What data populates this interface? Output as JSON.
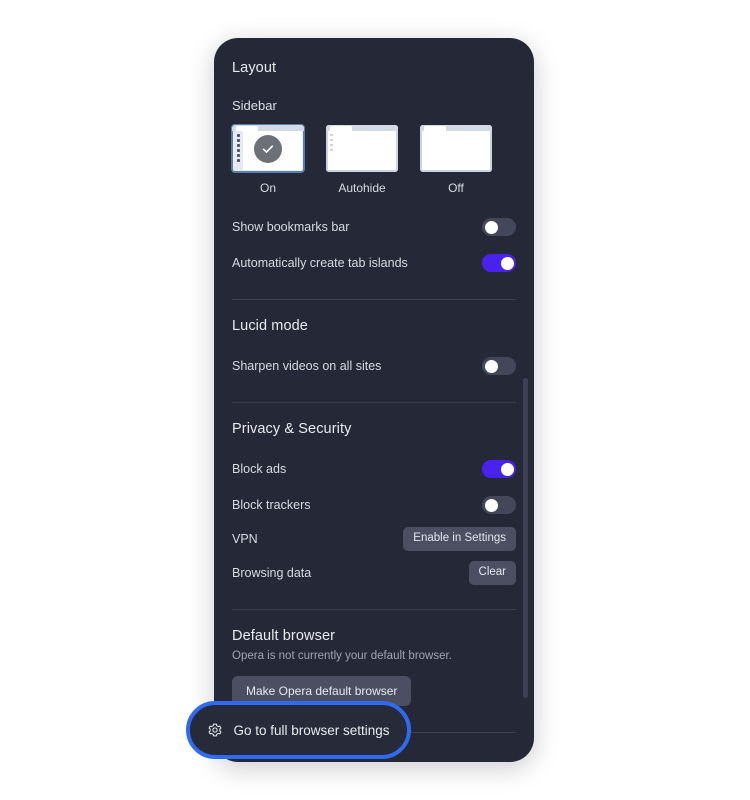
{
  "panel": {
    "sections": {
      "layout": {
        "title": "Layout",
        "sidebar_group_label": "Sidebar",
        "thumbnails": [
          {
            "caption": "On",
            "state": "selected",
            "icon": "check-icon"
          },
          {
            "caption": "Autohide",
            "state": "unselected"
          },
          {
            "caption": "Off",
            "state": "unselected"
          }
        ],
        "rows": [
          {
            "label": "Show bookmarks bar",
            "control": "toggle",
            "value": "off"
          },
          {
            "label": "Automatically create tab islands",
            "control": "toggle",
            "value": "on"
          }
        ]
      },
      "lucid": {
        "title": "Lucid mode",
        "rows": [
          {
            "label": "Sharpen videos on all sites",
            "control": "toggle",
            "value": "off"
          }
        ]
      },
      "privacy": {
        "title": "Privacy & Security",
        "rows": [
          {
            "label": "Block ads",
            "control": "toggle",
            "value": "on"
          },
          {
            "label": "Block trackers",
            "control": "toggle",
            "value": "off"
          },
          {
            "label": "VPN",
            "control": "button",
            "button_label": "Enable in Settings"
          },
          {
            "label": "Browsing data",
            "control": "button",
            "button_label": "Clear"
          }
        ]
      },
      "default_browser": {
        "title": "Default browser",
        "description": "Opera is not currently your default browser.",
        "button_label": "Make Opera default browser"
      }
    },
    "footer": {
      "icon": "gear-icon",
      "label": "Go to full browser settings"
    }
  },
  "colors": {
    "panel_bg": "#252836",
    "accent_toggle_on": "#4a22ef",
    "highlight_ring": "#2f6bf2",
    "button_bg": "#4b4f61",
    "divider": "#3a3e50",
    "page_bg": "#ffffff"
  }
}
